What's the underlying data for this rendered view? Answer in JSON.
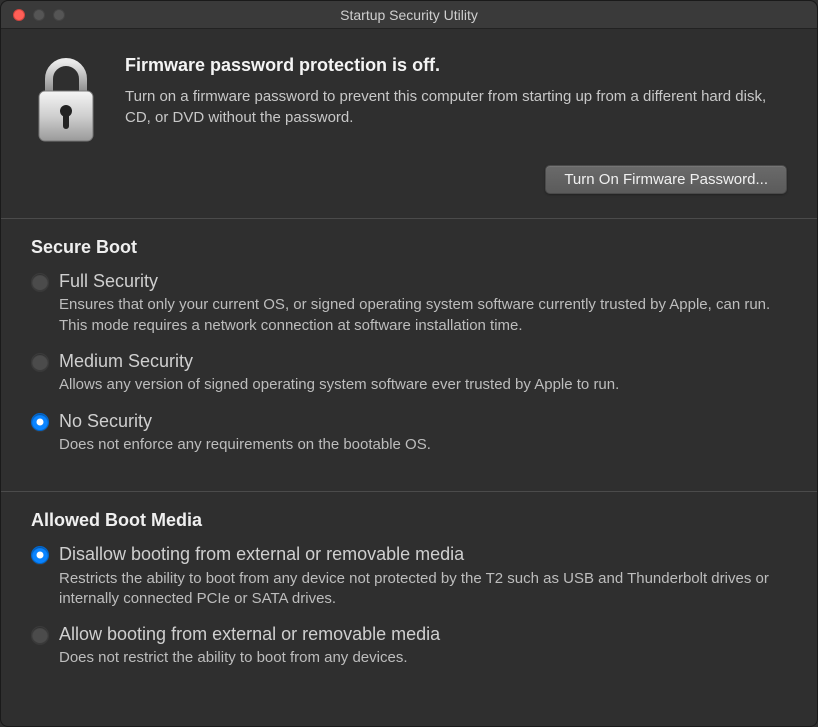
{
  "window": {
    "title": "Startup Security Utility"
  },
  "header": {
    "title": "Firmware password protection is off.",
    "description": "Turn on a firmware password to prevent this computer from starting up from a different hard disk, CD, or DVD without the password.",
    "button_label": "Turn On Firmware Password..."
  },
  "secure_boot": {
    "title": "Secure Boot",
    "options": [
      {
        "label": "Full Security",
        "description": "Ensures that only your current OS, or signed operating system software currently trusted by Apple, can run. This mode requires a network connection at software installation time.",
        "selected": false
      },
      {
        "label": "Medium Security",
        "description": "Allows any version of signed operating system software ever trusted by Apple to run.",
        "selected": false
      },
      {
        "label": "No Security",
        "description": "Does not enforce any requirements on the bootable OS.",
        "selected": true
      }
    ]
  },
  "boot_media": {
    "title": "Allowed Boot Media",
    "options": [
      {
        "label": "Disallow booting from external or removable media",
        "description": "Restricts the ability to boot from any device not protected by the T2 such as USB and Thunderbolt drives or internally connected PCIe or SATA drives.",
        "selected": true
      },
      {
        "label": "Allow booting from external or removable media",
        "description": "Does not restrict the ability to boot from any devices.",
        "selected": false
      }
    ]
  }
}
